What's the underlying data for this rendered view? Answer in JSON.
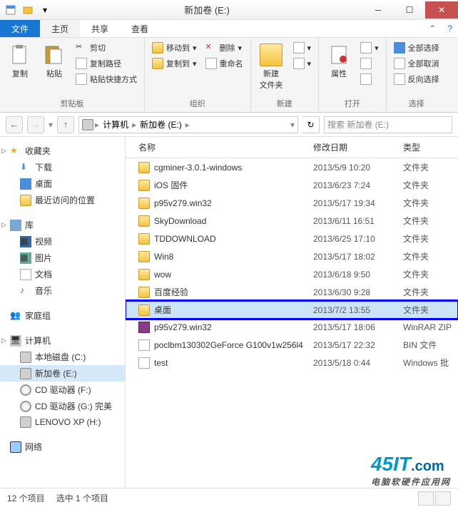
{
  "window": {
    "title": "新加卷 (E:)"
  },
  "menubar": {
    "file": "文件",
    "home": "主页",
    "share": "共享",
    "view": "查看"
  },
  "ribbon": {
    "clipboard": {
      "label": "剪贴板",
      "copy": "复制",
      "paste": "粘贴",
      "cut": "剪切",
      "copypath": "复制路径",
      "pasteshortcut": "粘贴快捷方式"
    },
    "organize": {
      "label": "组织",
      "moveto": "移动到",
      "copyto": "复制到",
      "delete": "删除",
      "rename": "重命名"
    },
    "new": {
      "label": "新建",
      "newfolder": "新建\n文件夹"
    },
    "open": {
      "label": "打开",
      "properties": "属性"
    },
    "select": {
      "label": "选择",
      "selectall": "全部选择",
      "selectnone": "全部取消",
      "invert": "反向选择"
    }
  },
  "address": {
    "crumbs": [
      "计算机",
      "新加卷 (E:)"
    ],
    "search_placeholder": "搜索 新加卷 (E:)"
  },
  "nav": {
    "favorites": {
      "label": "收藏夹",
      "items": [
        "下载",
        "桌面",
        "最近访问的位置"
      ]
    },
    "libraries": {
      "label": "库",
      "items": [
        "视频",
        "图片",
        "文档",
        "音乐"
      ]
    },
    "homegroup": {
      "label": "家庭组"
    },
    "computer": {
      "label": "计算机",
      "items": [
        "本地磁盘 (C:)",
        "新加卷 (E:)",
        "CD 驱动器 (F:)",
        "CD 驱动器 (G:) 完美",
        "LENOVO XP (H:)"
      ]
    },
    "network": {
      "label": "网络"
    }
  },
  "columns": {
    "name": "名称",
    "date": "修改日期",
    "type": "类型"
  },
  "files": [
    {
      "name": "cgminer-3.0.1-windows",
      "date": "2013/5/9 10:20",
      "type": "文件夹",
      "icon": "folder"
    },
    {
      "name": "iOS 固件",
      "date": "2013/6/23 7:24",
      "type": "文件夹",
      "icon": "folder"
    },
    {
      "name": "p95v279.win32",
      "date": "2013/5/17 19:34",
      "type": "文件夹",
      "icon": "folder"
    },
    {
      "name": "SkyDownload",
      "date": "2013/6/11 16:51",
      "type": "文件夹",
      "icon": "folder"
    },
    {
      "name": "TDDOWNLOAD",
      "date": "2013/6/25 17:10",
      "type": "文件夹",
      "icon": "folder"
    },
    {
      "name": "Win8",
      "date": "2013/5/17 18:02",
      "type": "文件夹",
      "icon": "folder"
    },
    {
      "name": "wow",
      "date": "2013/6/18 9:50",
      "type": "文件夹",
      "icon": "folder"
    },
    {
      "name": "百度经验",
      "date": "2013/6/30 9:28",
      "type": "文件夹",
      "icon": "folder"
    },
    {
      "name": "桌面",
      "date": "2013/7/2 13:55",
      "type": "文件夹",
      "icon": "folder",
      "selected": true
    },
    {
      "name": "p95v279.win32",
      "date": "2013/5/17 18:06",
      "type": "WinRAR ZIP",
      "icon": "zip"
    },
    {
      "name": "poclbm130302GeForce G100v1w256l4",
      "date": "2013/5/17 22:32",
      "type": "BIN 文件",
      "icon": "bin"
    },
    {
      "name": "test",
      "date": "2013/5/18 0:44",
      "type": "Windows 批",
      "icon": "bat"
    }
  ],
  "status": {
    "count": "12 个项目",
    "selected": "选中 1 个项目"
  },
  "watermark": {
    "brand1": "45",
    "brand2": "IT",
    "brand3": ".com",
    "sub": "电脑软硬件应用网"
  }
}
